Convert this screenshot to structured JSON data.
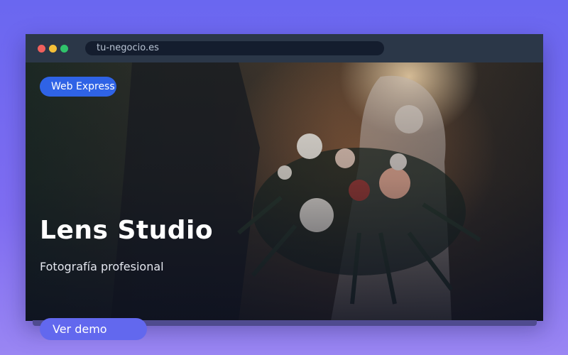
{
  "browser": {
    "url": "tu-negocio.es"
  },
  "hero": {
    "badge": "Web Express",
    "title": "Lens Studio",
    "subtitle": "Fotografía profesional",
    "cta_label": "Ver demo"
  },
  "colors": {
    "background": "#6a67f0",
    "titlebar": "#2b3748",
    "badge": "#2f63e6",
    "cta": "#6268ee"
  }
}
